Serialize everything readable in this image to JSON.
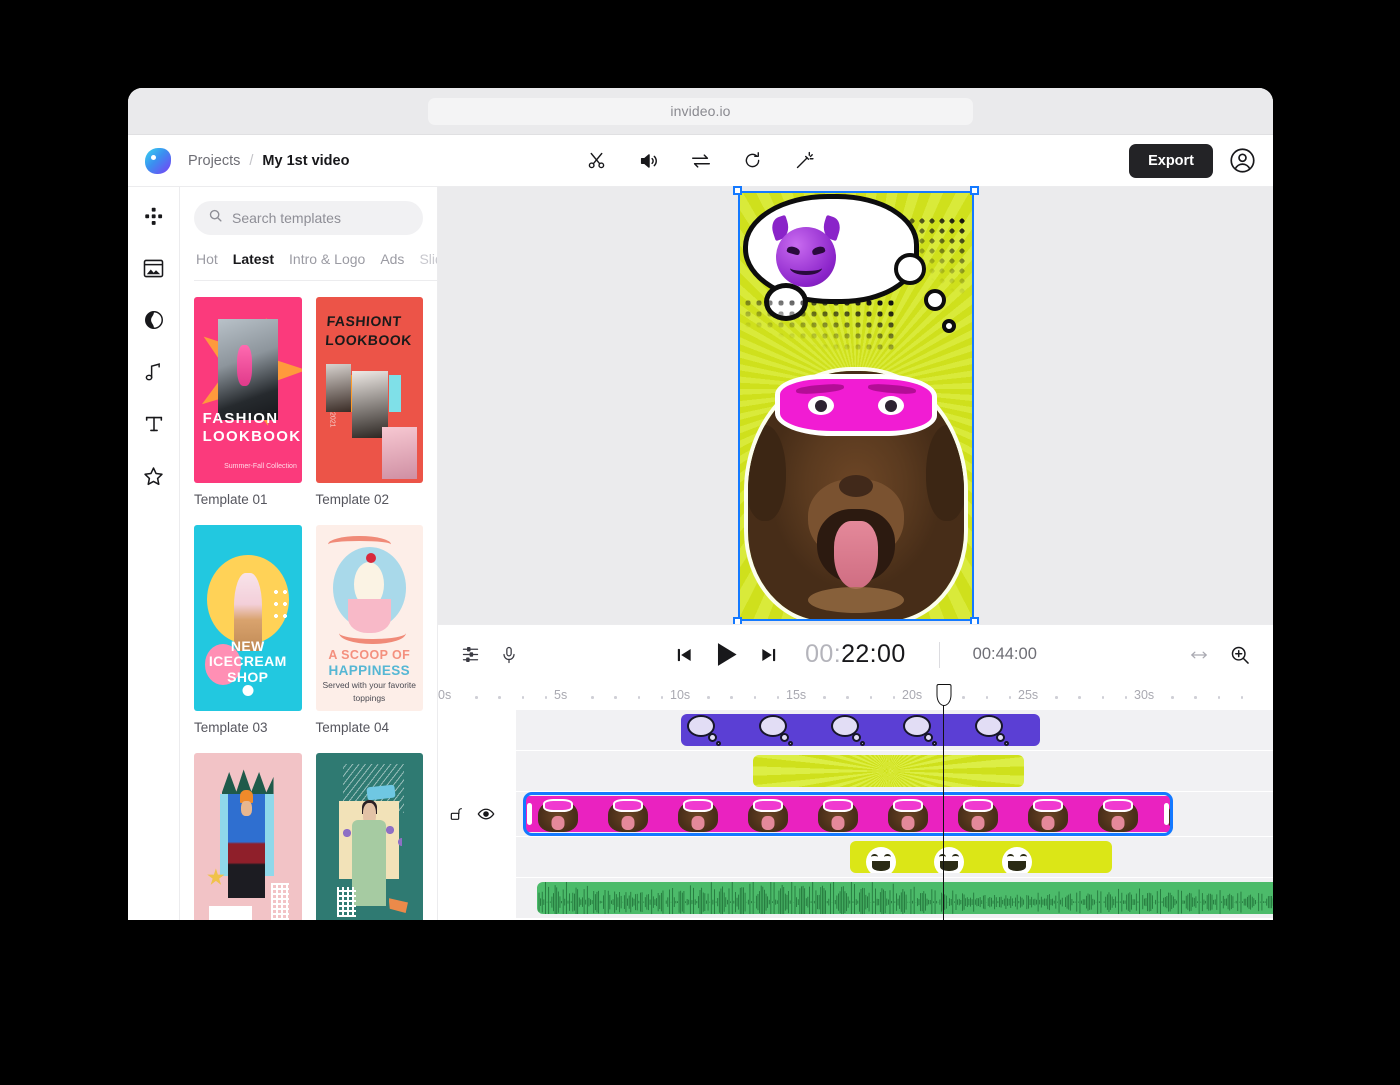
{
  "browser": {
    "url": "invideo.io"
  },
  "header": {
    "logo_icon": "invideo-logo-icon",
    "breadcrumb": {
      "root": "Projects",
      "separator": "/",
      "current": "My 1st video"
    },
    "tools": [
      {
        "name": "cut-icon",
        "label": "Cut"
      },
      {
        "name": "volume-icon",
        "label": "Volume"
      },
      {
        "name": "transition-icon",
        "label": "Transition"
      },
      {
        "name": "rotate-icon",
        "label": "Rotate"
      },
      {
        "name": "magic-wand-icon",
        "label": "Magic"
      }
    ],
    "export_label": "Export",
    "avatar_icon": "user-avatar-icon"
  },
  "rail": {
    "items": [
      {
        "name": "sidebar-item-templates",
        "icon": "grid-blocks-icon"
      },
      {
        "name": "sidebar-item-media",
        "icon": "image-frame-icon"
      },
      {
        "name": "sidebar-item-filters",
        "icon": "contrast-circle-icon"
      },
      {
        "name": "sidebar-item-music",
        "icon": "music-note-icon"
      },
      {
        "name": "sidebar-item-text",
        "icon": "text-t-icon"
      },
      {
        "name": "sidebar-item-stickers",
        "icon": "star-icon"
      }
    ]
  },
  "panel": {
    "search": {
      "placeholder": "Search templates",
      "value": "",
      "icon": "search-icon"
    },
    "tabs": [
      {
        "label": "Hot",
        "active": false,
        "faded": false
      },
      {
        "label": "Latest",
        "active": true,
        "faded": false
      },
      {
        "label": "Intro & Logo",
        "active": false,
        "faded": false
      },
      {
        "label": "Ads",
        "active": false,
        "faded": false
      },
      {
        "label": "Slid",
        "active": false,
        "faded": true
      }
    ],
    "templates": [
      {
        "label": "Template 01",
        "art": "t01",
        "title_line1": "FASHION",
        "title_line2": "LOOKBOOK",
        "subtitle": "Summer-Fall Collection"
      },
      {
        "label": "Template 02",
        "art": "t02",
        "title_line1": "FASHIONT",
        "title_line2": "LOOKBOOK",
        "year": "2021"
      },
      {
        "label": "Template 03",
        "art": "t03",
        "title_line1": "NEW",
        "title_line2": "ICECREAM",
        "title_line3": "SHOP"
      },
      {
        "label": "Template 04",
        "art": "t04",
        "title_line1": "A SCOOP OF",
        "title_line2": "HAPPINESS",
        "subtitle": "Served with your favorite toppings"
      },
      {
        "label": "",
        "art": "t05"
      },
      {
        "label": "",
        "art": "t06"
      }
    ]
  },
  "stage": {
    "selection": {
      "handles": 4,
      "border_color": "#1479ff"
    },
    "layers": [
      {
        "name": "thought-bubble-layer",
        "content": "devil-emoji"
      },
      {
        "name": "sunburst-background-layer",
        "color": "#d2e31e"
      },
      {
        "name": "dog-photo-layer",
        "content": "chocolate-labrador"
      },
      {
        "name": "eye-mask-overlay-layer",
        "color": "#e321c8"
      }
    ]
  },
  "transport": {
    "left_icons": [
      {
        "name": "tracks-icon"
      },
      {
        "name": "microphone-icon"
      }
    ],
    "prev_icon": "skip-previous-icon",
    "play_icon": "play-icon",
    "next_icon": "skip-next-icon",
    "current_time_dim": "00:",
    "current_time_on": "22:00",
    "total_time": "00:44:00",
    "right_icons": [
      {
        "name": "fit-width-icon"
      },
      {
        "name": "zoom-in-icon"
      }
    ]
  },
  "timeline": {
    "ruler": {
      "labels": [
        "0s",
        "5s",
        "10s",
        "15s",
        "20s",
        "25s",
        "30s"
      ],
      "ticks_between": 4,
      "pixels_per_second": 23.2
    },
    "playhead": {
      "time_seconds": 18.4,
      "label": "00:22:00"
    },
    "track_controls": [
      {
        "name": "lock-icon",
        "state": "unlocked"
      },
      {
        "name": "visibility-eye-icon",
        "state": "visible"
      }
    ],
    "tracks": [
      {
        "name": "thought-bubble-track",
        "clip": "thought-bubbles",
        "color": "#5b3fd4",
        "start_s": 7.1,
        "end_s": 22.6,
        "selected": false
      },
      {
        "name": "background-track",
        "clip": "sunburst-background",
        "color": "#d2e31e",
        "start_s": 10.2,
        "end_s": 21.9,
        "selected": false
      },
      {
        "name": "video-track",
        "clip": "dog-video",
        "color": "#ea22c0",
        "start_s": 0.3,
        "end_s": 28.3,
        "selected": true
      },
      {
        "name": "emoji-track",
        "clip": "laughing-emoji",
        "color": "#dbe617",
        "start_s": 14.4,
        "end_s": 25.7,
        "selected": false
      },
      {
        "name": "audio-track",
        "clip": "audio-waveform",
        "color": "#4cbb6a",
        "start_s": 0.9,
        "end_s": 33.0,
        "selected": false
      }
    ]
  }
}
